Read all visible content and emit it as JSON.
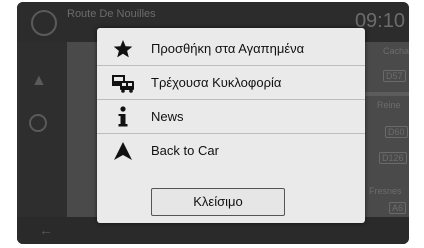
{
  "background": {
    "street_name": "Route De Nouilles",
    "time": "09:10",
    "place_1": "Cachan",
    "place_2": "Reine",
    "place_3": "Fresnes",
    "road_tag_1": "D57",
    "road_tag_2": "D60",
    "road_tag_3": "D126",
    "road_tag_4": "A6"
  },
  "menu": {
    "items": [
      {
        "label": "Προσθήκη στα Αγαπημένα",
        "icon": "star-icon"
      },
      {
        "label": "Τρέχουσα Κυκλοφορία",
        "icon": "traffic-icon"
      },
      {
        "label": "News",
        "icon": "info-icon"
      },
      {
        "label": "Back to Car",
        "icon": "navigation-arrow-icon"
      }
    ],
    "close_label": "Κλείσιμο"
  },
  "colors": {
    "popup_bg": "#eaeaea",
    "dim_bg": "#3a3a3a",
    "icon": "#111111"
  }
}
